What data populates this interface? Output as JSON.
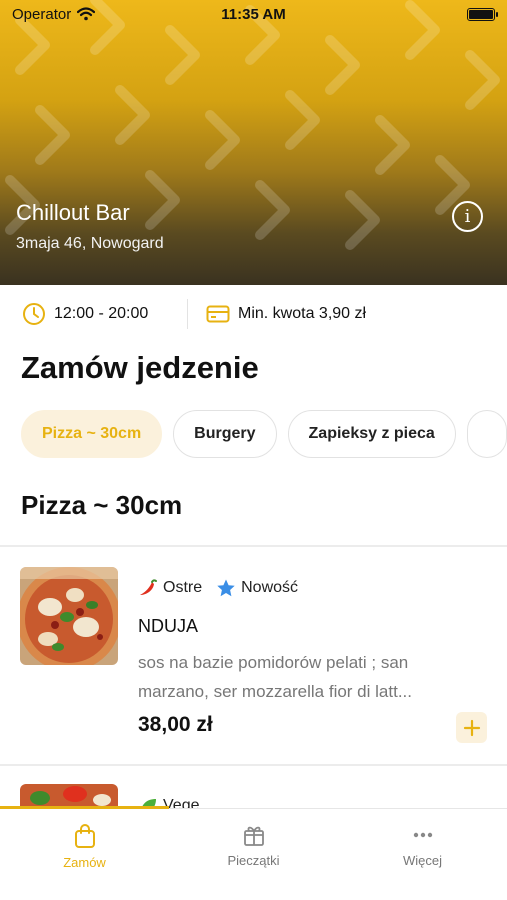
{
  "status_bar": {
    "carrier": "Operator",
    "time": "11:35 AM"
  },
  "venue": {
    "name": "Chillout Bar",
    "address": "3maja 46, Nowogard"
  },
  "info": {
    "hours": "12:00 - 20:00",
    "min_order": "Min. kwota 3,90 zł"
  },
  "page_title": "Zamów jedzenie",
  "categories": [
    {
      "label": "Pizza ~ 30cm",
      "active": true
    },
    {
      "label": "Burgery",
      "active": false
    },
    {
      "label": "Zapieksy z pieca",
      "active": false
    }
  ],
  "section": {
    "title": "Pizza ~ 30cm"
  },
  "items": [
    {
      "tags": [
        "Ostre",
        "Nowość"
      ],
      "name": "NDUJA",
      "description_line1": "sos na bazie pomidorów pelati ; san",
      "description_line2": "marzano, ser mozzarella fior di latt...",
      "price": "38,00 zł"
    },
    {
      "tags": [
        "Vege"
      ]
    }
  ],
  "tabbar": [
    {
      "label": "Zamów",
      "icon": "bag-icon",
      "active": true
    },
    {
      "label": "Pieczątki",
      "icon": "gift-icon",
      "active": false
    },
    {
      "label": "Więcej",
      "icon": "more-icon",
      "active": false
    }
  ],
  "colors": {
    "accent": "#e7b211",
    "accent_light": "#fbf1dc",
    "hero_top": "#eeb81a"
  }
}
